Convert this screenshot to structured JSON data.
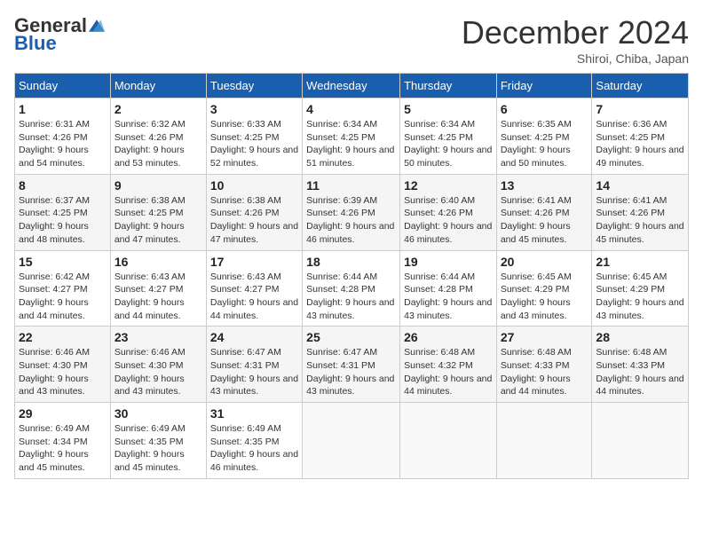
{
  "header": {
    "logo_general": "General",
    "logo_blue": "Blue",
    "month_title": "December 2024",
    "subtitle": "Shiroi, Chiba, Japan"
  },
  "days_of_week": [
    "Sunday",
    "Monday",
    "Tuesday",
    "Wednesday",
    "Thursday",
    "Friday",
    "Saturday"
  ],
  "weeks": [
    [
      {
        "day": "1",
        "sunrise": "6:31 AM",
        "sunset": "4:26 PM",
        "daylight_h": "9",
        "daylight_m": "54"
      },
      {
        "day": "2",
        "sunrise": "6:32 AM",
        "sunset": "4:26 PM",
        "daylight_h": "9",
        "daylight_m": "53"
      },
      {
        "day": "3",
        "sunrise": "6:33 AM",
        "sunset": "4:25 PM",
        "daylight_h": "9",
        "daylight_m": "52"
      },
      {
        "day": "4",
        "sunrise": "6:34 AM",
        "sunset": "4:25 PM",
        "daylight_h": "9",
        "daylight_m": "51"
      },
      {
        "day": "5",
        "sunrise": "6:34 AM",
        "sunset": "4:25 PM",
        "daylight_h": "9",
        "daylight_m": "50"
      },
      {
        "day": "6",
        "sunrise": "6:35 AM",
        "sunset": "4:25 PM",
        "daylight_h": "9",
        "daylight_m": "50"
      },
      {
        "day": "7",
        "sunrise": "6:36 AM",
        "sunset": "4:25 PM",
        "daylight_h": "9",
        "daylight_m": "49"
      }
    ],
    [
      {
        "day": "8",
        "sunrise": "6:37 AM",
        "sunset": "4:25 PM",
        "daylight_h": "9",
        "daylight_m": "48"
      },
      {
        "day": "9",
        "sunrise": "6:38 AM",
        "sunset": "4:25 PM",
        "daylight_h": "9",
        "daylight_m": "47"
      },
      {
        "day": "10",
        "sunrise": "6:38 AM",
        "sunset": "4:26 PM",
        "daylight_h": "9",
        "daylight_m": "47"
      },
      {
        "day": "11",
        "sunrise": "6:39 AM",
        "sunset": "4:26 PM",
        "daylight_h": "9",
        "daylight_m": "46"
      },
      {
        "day": "12",
        "sunrise": "6:40 AM",
        "sunset": "4:26 PM",
        "daylight_h": "9",
        "daylight_m": "46"
      },
      {
        "day": "13",
        "sunrise": "6:41 AM",
        "sunset": "4:26 PM",
        "daylight_h": "9",
        "daylight_m": "45"
      },
      {
        "day": "14",
        "sunrise": "6:41 AM",
        "sunset": "4:26 PM",
        "daylight_h": "9",
        "daylight_m": "45"
      }
    ],
    [
      {
        "day": "15",
        "sunrise": "6:42 AM",
        "sunset": "4:27 PM",
        "daylight_h": "9",
        "daylight_m": "44"
      },
      {
        "day": "16",
        "sunrise": "6:43 AM",
        "sunset": "4:27 PM",
        "daylight_h": "9",
        "daylight_m": "44"
      },
      {
        "day": "17",
        "sunrise": "6:43 AM",
        "sunset": "4:27 PM",
        "daylight_h": "9",
        "daylight_m": "44"
      },
      {
        "day": "18",
        "sunrise": "6:44 AM",
        "sunset": "4:28 PM",
        "daylight_h": "9",
        "daylight_m": "43"
      },
      {
        "day": "19",
        "sunrise": "6:44 AM",
        "sunset": "4:28 PM",
        "daylight_h": "9",
        "daylight_m": "43"
      },
      {
        "day": "20",
        "sunrise": "6:45 AM",
        "sunset": "4:29 PM",
        "daylight_h": "9",
        "daylight_m": "43"
      },
      {
        "day": "21",
        "sunrise": "6:45 AM",
        "sunset": "4:29 PM",
        "daylight_h": "9",
        "daylight_m": "43"
      }
    ],
    [
      {
        "day": "22",
        "sunrise": "6:46 AM",
        "sunset": "4:30 PM",
        "daylight_h": "9",
        "daylight_m": "43"
      },
      {
        "day": "23",
        "sunrise": "6:46 AM",
        "sunset": "4:30 PM",
        "daylight_h": "9",
        "daylight_m": "43"
      },
      {
        "day": "24",
        "sunrise": "6:47 AM",
        "sunset": "4:31 PM",
        "daylight_h": "9",
        "daylight_m": "43"
      },
      {
        "day": "25",
        "sunrise": "6:47 AM",
        "sunset": "4:31 PM",
        "daylight_h": "9",
        "daylight_m": "43"
      },
      {
        "day": "26",
        "sunrise": "6:48 AM",
        "sunset": "4:32 PM",
        "daylight_h": "9",
        "daylight_m": "44"
      },
      {
        "day": "27",
        "sunrise": "6:48 AM",
        "sunset": "4:33 PM",
        "daylight_h": "9",
        "daylight_m": "44"
      },
      {
        "day": "28",
        "sunrise": "6:48 AM",
        "sunset": "4:33 PM",
        "daylight_h": "9",
        "daylight_m": "44"
      }
    ],
    [
      {
        "day": "29",
        "sunrise": "6:49 AM",
        "sunset": "4:34 PM",
        "daylight_h": "9",
        "daylight_m": "45"
      },
      {
        "day": "30",
        "sunrise": "6:49 AM",
        "sunset": "4:35 PM",
        "daylight_h": "9",
        "daylight_m": "45"
      },
      {
        "day": "31",
        "sunrise": "6:49 AM",
        "sunset": "4:35 PM",
        "daylight_h": "9",
        "daylight_m": "46"
      },
      null,
      null,
      null,
      null
    ]
  ],
  "labels": {
    "sunrise": "Sunrise:",
    "sunset": "Sunset:",
    "daylight": "Daylight: {h} hours and {m} minutes."
  }
}
